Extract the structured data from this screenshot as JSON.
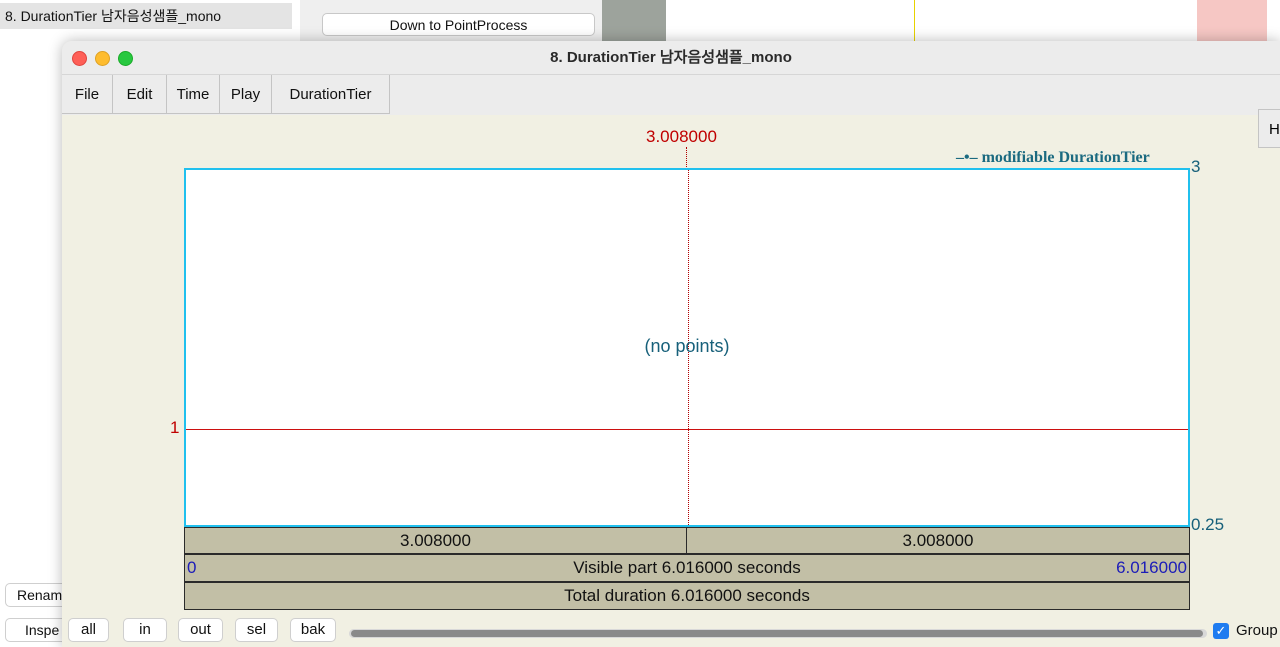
{
  "background": {
    "objects_list_item": "8. DurationTier 남자음성샘플_mono",
    "dynamic_button": "Down to PointProcess",
    "rename_button": "Renam",
    "inspect_button": "Inspe"
  },
  "window": {
    "title": "8. DurationTier 남자음성샘플_mono",
    "menus": [
      "File",
      "Edit",
      "Time",
      "Play",
      "DurationTier"
    ],
    "help_menu": "H"
  },
  "editor": {
    "cursor_time": "3.008000",
    "legend": "–•– modifiable DurationTier",
    "no_points": "(no points)",
    "y_max": "3",
    "y_min": "0.25",
    "y_ref": "1",
    "left_duration": "3.008000",
    "right_duration": "3.008000",
    "visible_start": "0",
    "visible_end": "6.016000",
    "visible_part": "Visible part 6.016000 seconds",
    "total_duration": "Total duration 6.016000 seconds"
  },
  "bottom": {
    "buttons": [
      "all",
      "in",
      "out",
      "sel",
      "bak"
    ],
    "group_label": "Group",
    "group_checked": true
  }
}
